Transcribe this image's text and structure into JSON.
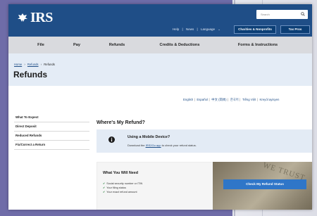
{
  "header": {
    "logo_text": "IRS",
    "search_placeholder": "Search",
    "utility_links": [
      "Help",
      "|",
      "News",
      "|",
      "Language",
      "⌄"
    ],
    "charities_button": "Charities & Nonprofits",
    "taxpros_button": "Tax Pros"
  },
  "nav": {
    "items": [
      "File",
      "Pay",
      "Refunds",
      "Credits & Deductions",
      "Forms & Instructions"
    ]
  },
  "breadcrumb": {
    "home": "Home",
    "refunds": "Refunds",
    "current": "Refunds",
    "separator": "›"
  },
  "page_title": "Refunds",
  "languages": [
    "English",
    "Español",
    "中文 (简体)",
    "한국어",
    "Tiếng Việt",
    "Kreyòl ayisyen"
  ],
  "sidebar": {
    "items": [
      "What To Expect",
      "Direct Deposit",
      "Reduced Refunds",
      "Fix/Correct a Return"
    ]
  },
  "main": {
    "heading": "Where's My Refund?",
    "mobile": {
      "title": "Using a Mobile Device?",
      "text_before": "Download the ",
      "link": "IRS2Go app",
      "text_after": " to check your refund status."
    },
    "need": {
      "title": "What You Will Need",
      "items": [
        "Social security number or ITIN",
        "Your filing status",
        "Your exact refund amount"
      ]
    },
    "photo_text": "WE TRUST",
    "check_button": "Check My Refund Status"
  },
  "colors": {
    "header_bg": "#1f4e87",
    "nav_bg": "#d9dade",
    "title_band": "#e4ecf6",
    "cta": "#2f76c8",
    "check": "#2e8540"
  }
}
